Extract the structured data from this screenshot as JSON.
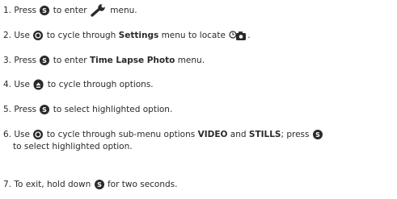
{
  "steps": [
    {
      "n": "1.",
      "a": "Press",
      "b": "to enter",
      "c": "menu."
    },
    {
      "n": "2.",
      "a": "Use",
      "b": "to cycle through",
      "bold": "Settings",
      "c": "menu to locate",
      "d": "."
    },
    {
      "n": "3.",
      "a": "Press",
      "b": "to enter",
      "bold": "Time Lapse Photo",
      "c": "menu."
    },
    {
      "n": "4.",
      "a": "Use",
      "b": "to cycle through options."
    },
    {
      "n": "5.",
      "a": "Press",
      "b": "to select highlighted option."
    },
    {
      "n": "6.",
      "a": "Use",
      "b": "to cycle through sub-menu options",
      "bold1": "VIDEO",
      "c": "and",
      "bold2": "STILLS",
      "d": "; press",
      "e": "to select highlighted option."
    },
    {
      "n": "7.",
      "a": "To exit, hold down",
      "b": "for two seconds."
    }
  ],
  "icons": {
    "select": "select-button-icon",
    "cycle": "cycle-button-icon",
    "up": "up-button-icon",
    "wrench": "wrench-icon",
    "timelapse": "time-lapse-camera-icon"
  }
}
